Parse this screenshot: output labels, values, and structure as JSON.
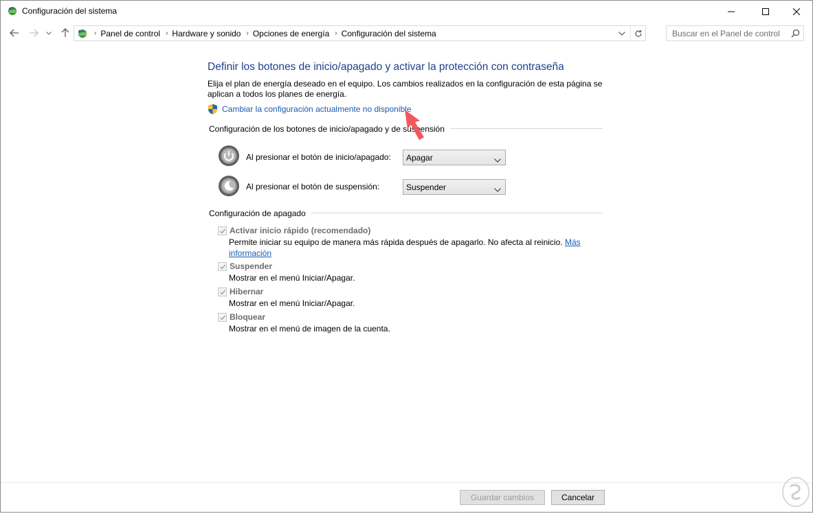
{
  "window": {
    "title": "Configuración del sistema"
  },
  "address": {
    "breadcrumbs": [
      "Panel de control",
      "Hardware y sonido",
      "Opciones de energía",
      "Configuración del sistema"
    ]
  },
  "search": {
    "placeholder": "Buscar en el Panel de control"
  },
  "main": {
    "heading": "Definir los botones de inicio/apagado y activar la protección con contraseña",
    "description": "Elija el plan de energía deseado en el equipo. Los cambios realizados en la configuración de esta página se aplican a todos los planes de energía.",
    "change_settings_link": "Cambiar la configuración actualmente no disponible",
    "buttons_section": {
      "title": "Configuración de los botones de inicio/apagado y de suspensión",
      "power_button_label": "Al presionar el botón de inicio/apagado:",
      "power_button_value": "Apagar",
      "sleep_button_label": "Al presionar el botón de suspensión:",
      "sleep_button_value": "Suspender"
    },
    "shutdown_section": {
      "title": "Configuración de apagado",
      "fast_startup": {
        "label": "Activar inicio rápido (recomendado)",
        "checked": true,
        "description": "Permite iniciar su equipo de manera más rápida después de apagarlo. No afecta al reinicio.",
        "more_link_1": "Más",
        "more_link_2": "información"
      },
      "sleep": {
        "label": "Suspender",
        "checked": true,
        "description": "Mostrar en el menú Iniciar/Apagar."
      },
      "hibernate": {
        "label": "Hibernar",
        "checked": true,
        "description": "Mostrar en el menú Iniciar/Apagar."
      },
      "lock": {
        "label": "Bloquear",
        "checked": true,
        "description": "Mostrar en el menú de imagen de la cuenta."
      }
    }
  },
  "footer": {
    "save_label": "Guardar cambios",
    "cancel_label": "Cancelar"
  },
  "colors": {
    "heading": "#1e3f8c",
    "link": "#1a5aaf",
    "arrow": "#f2575d"
  }
}
